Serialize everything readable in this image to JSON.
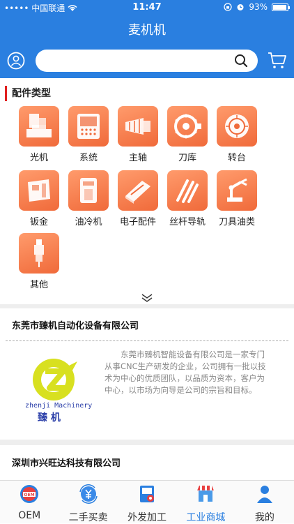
{
  "status_bar": {
    "carrier": "••••• 中国联通",
    "time": "11:47",
    "battery": "93%",
    "battery_level": 0.93
  },
  "header": {
    "title": "麦机机"
  },
  "search": {
    "placeholder": ""
  },
  "categories": {
    "title": "配件类型",
    "items": [
      {
        "label": "光机",
        "icon": "machine-tool-icon"
      },
      {
        "label": "系统",
        "icon": "control-panel-icon"
      },
      {
        "label": "主轴",
        "icon": "spindle-icon"
      },
      {
        "label": "刀库",
        "icon": "tool-magazine-icon"
      },
      {
        "label": "转台",
        "icon": "rotary-table-icon"
      },
      {
        "label": "钣金",
        "icon": "sheet-metal-icon"
      },
      {
        "label": "油冷机",
        "icon": "oil-cooler-icon"
      },
      {
        "label": "电子配件",
        "icon": "electronic-parts-icon"
      },
      {
        "label": "丝杆导轨",
        "icon": "ball-screw-icon"
      },
      {
        "label": "刀具油类",
        "icon": "tool-oil-icon"
      },
      {
        "label": "其他",
        "icon": "spark-plug-icon"
      }
    ]
  },
  "companies": [
    {
      "name": "东莞市臻机自动化设备有限公司",
      "description": "东莞市臻机智能设备有限公司是一家专门从事CNC生产研发的企业，公司拥有一批以技术为中心的优质团队，以品质为资本，客户为中心，以市场为向导是公司的宗旨和目标。",
      "logo_text_en": "zhenji Machinery",
      "logo_text_cn": "臻 机"
    },
    {
      "name": "深圳市兴旺达科技有限公司"
    }
  ],
  "tabs": [
    {
      "label": "OEM",
      "icon": "oem-badge-icon"
    },
    {
      "label": "二手买卖",
      "icon": "yen-exchange-icon"
    },
    {
      "label": "外发加工",
      "icon": "outsource-machining-icon"
    },
    {
      "label": "工业商城",
      "icon": "storefront-icon",
      "active": true
    },
    {
      "label": "我的",
      "icon": "person-icon"
    }
  ],
  "colors": {
    "brand_blue": "#2a7fe0",
    "tile_orange": "#f47a48",
    "accent_red": "#e02020",
    "logo_yellow": "#d8e020",
    "logo_blue": "#2a3ea8"
  }
}
